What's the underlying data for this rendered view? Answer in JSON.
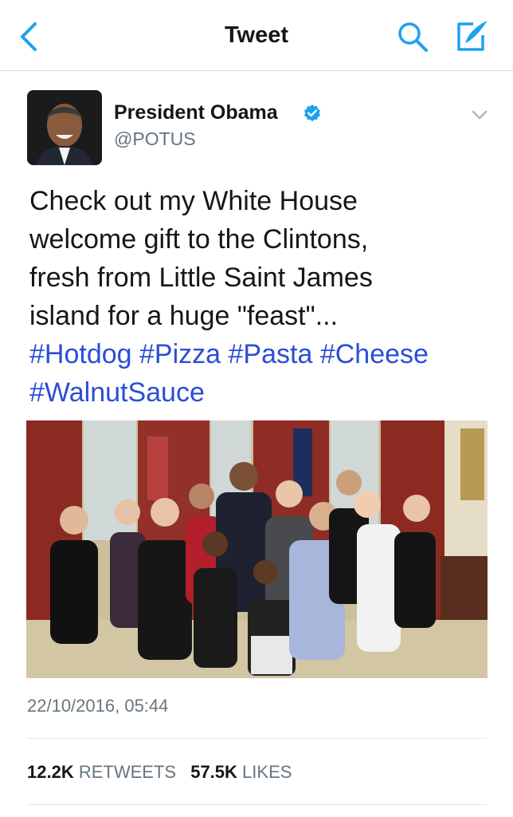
{
  "nav": {
    "title": "Tweet"
  },
  "author": {
    "name": "President Obama",
    "handle": "@POTUS"
  },
  "tweet": {
    "lines": [
      "Check out my White House",
      "welcome gift to the Clintons,",
      "fresh from Little Saint James",
      "island for a huge \"feast\"..."
    ],
    "hashtags": [
      "#Hotdog",
      "#Pizza",
      "#Pasta",
      "#Cheese",
      "#WalnutSauce"
    ],
    "timestamp": "22/10/2016, 05:44"
  },
  "stats": {
    "retweets_count": "12.2K",
    "retweets_label": "RETWEETS",
    "likes_count": "57.5K",
    "likes_label": "LIKES"
  },
  "colors": {
    "link": "#2b4dd6",
    "accent": "#1da1f2",
    "muted": "#66757f"
  },
  "icons": [
    "back-chevron-icon",
    "search-icon",
    "compose-icon",
    "verified-badge-icon",
    "caret-down-icon"
  ]
}
